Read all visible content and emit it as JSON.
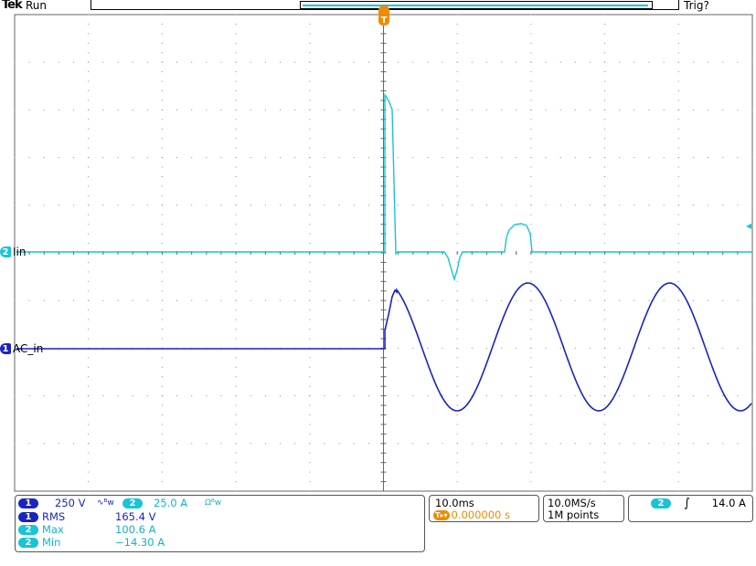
{
  "header": {
    "brand": "Tek",
    "acq_state": "Run",
    "trigger_status": "Trig?"
  },
  "channels": {
    "ch2": {
      "number": "2",
      "label": "Iin",
      "color": "#18c4d6"
    },
    "ch1": {
      "number": "1",
      "label": "AC_in",
      "color": "#1a24c0"
    }
  },
  "markers": {
    "trigger_pos": "T",
    "trigger_level_arrow": "◂"
  },
  "vertical": {
    "ch1_scale": "250 V",
    "ch1_coupling_icon": "∿ᴮw",
    "ch2_scale": "25.0 A",
    "ch2_coupling_icon": "Ωᴮw"
  },
  "measurements": [
    {
      "ch": "1",
      "name": "RMS",
      "value": "165.4 V"
    },
    {
      "ch": "2",
      "name": "Max",
      "value": "100.6 A"
    },
    {
      "ch": "2",
      "name": "Min",
      "value": "−14.30 A"
    }
  ],
  "horizontal": {
    "time_div": "10.0ms",
    "trigger_offset_icon": "T▸▾",
    "trigger_offset": "0.000000 s",
    "sample_rate": "10.0MS/s",
    "record_length": "1M points"
  },
  "trigger": {
    "source": "2",
    "slope_icon": "rising-edge-icon",
    "slope_glyph": "∫",
    "level": "14.0 A"
  },
  "colors": {
    "ch1": "#1a24c0",
    "ch2": "#18c4d6",
    "trigger": "#f08a00"
  }
}
